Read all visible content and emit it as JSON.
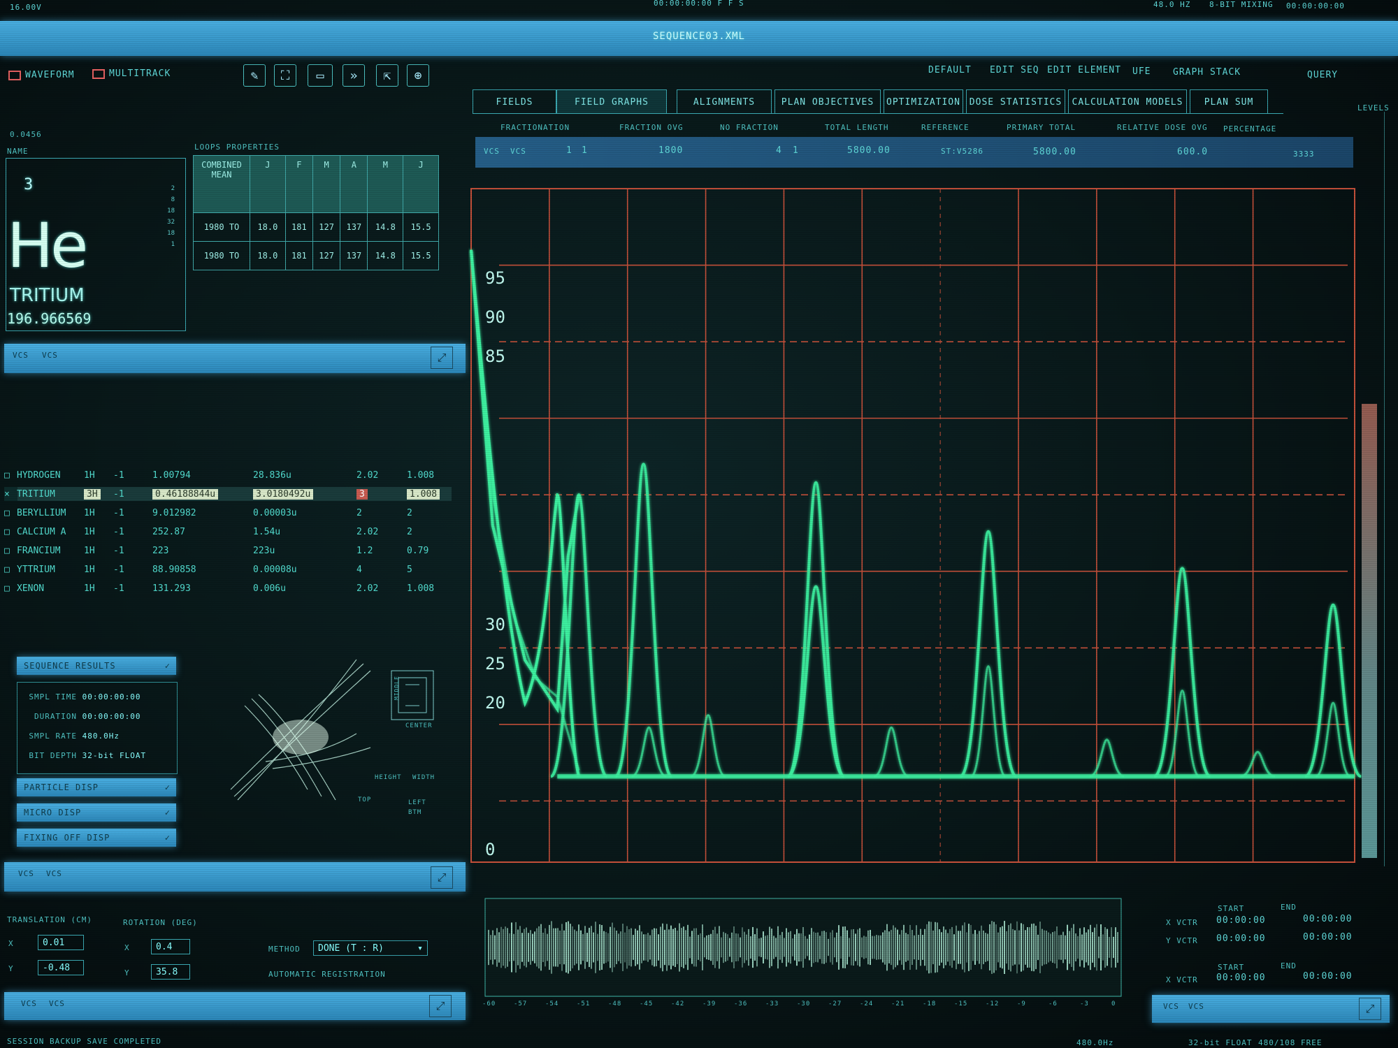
{
  "topbar": {
    "left": "16.00V",
    "center": "00:00:00:00 F F S",
    "right_rate": "48.0 HZ",
    "right_bits": "8-BIT MIXING",
    "right_tc": "00:00:00:00"
  },
  "title": "SEQUENCE03.XML",
  "toolbar": {
    "waveform": "WAVEFORM",
    "multitrack": "MULTITRACK"
  },
  "menu": [
    "DEFAULT",
    "EDIT SEQ",
    "EDIT ELEMENT",
    "UFE",
    "GRAPH STACK",
    "QUERY"
  ],
  "tabs": [
    "FIELDS",
    "FIELD GRAPHS",
    "ALIGNMENTS",
    "PLAN OBJECTIVES",
    "OPTIMIZATION",
    "DOSE STATISTICS",
    "CALCULATION MODELS",
    "PLAN SUM"
  ],
  "subheaders": [
    "FRACTIONATION",
    "FRACTION OVG",
    "NO FRACTION",
    "TOTAL LENGTH",
    "REFERENCE",
    "PRIMARY TOTAL",
    "RELATIVE DOSE OVG",
    "PERCENTAGE"
  ],
  "datarow": [
    "VCS",
    "VCS",
    "1",
    "1",
    "1800",
    "4",
    "1",
    "5800.00",
    "ST:V5286",
    "5800.00",
    "600.0",
    "3333"
  ],
  "levels_label": "LEVELS",
  "element": {
    "small_label": "0.0456",
    "name_label": "NAME",
    "number": "3",
    "symbol": "He",
    "name": "TRITIUM",
    "mass": "196.966569",
    "shells": [
      "2",
      "8",
      "18",
      "32",
      "18",
      "1"
    ]
  },
  "loops": {
    "title": "LOOPS  PROPERTIES",
    "headers": [
      "COMBINED MEAN",
      "J",
      "F",
      "M",
      "A",
      "M",
      "J"
    ],
    "rows": [
      [
        "1980  TO",
        "18.0",
        "181",
        "127",
        "137",
        "14.8",
        "15.5"
      ],
      [
        "1980  TO",
        "18.0",
        "181",
        "127",
        "137",
        "14.8",
        "15.5"
      ]
    ]
  },
  "vcs_bar": {
    "a": "VCS",
    "b": "VCS"
  },
  "elements": [
    {
      "name": "HYDROGEN",
      "iso": "1H",
      "charge": "-1",
      "mass": "1.00794",
      "unit": "28.836u",
      "v1": "2.02",
      "v2": "1.008"
    },
    {
      "name": "TRITIUM",
      "iso": "3H",
      "charge": "-1",
      "mass": "0.46188844u",
      "unit": "3.0180492u",
      "v1": "3",
      "v2": "1.008"
    },
    {
      "name": "BERYLLIUM",
      "iso": "1H",
      "charge": "-1",
      "mass": "9.012982",
      "unit": "0.00003u",
      "v1": "2",
      "v2": "2"
    },
    {
      "name": "CALCIUM A",
      "iso": "1H",
      "charge": "-1",
      "mass": "252.87",
      "unit": "1.54u",
      "v1": "2.02",
      "v2": "2"
    },
    {
      "name": "FRANCIUM",
      "iso": "1H",
      "charge": "-1",
      "mass": "223",
      "unit": "223u",
      "v1": "1.2",
      "v2": "0.79"
    },
    {
      "name": "YTTRIUM",
      "iso": "1H",
      "charge": "-1",
      "mass": "88.90858",
      "unit": "0.00008u",
      "v1": "4",
      "v2": "5"
    },
    {
      "name": "XENON",
      "iso": "1H",
      "charge": "-1",
      "mass": "131.293",
      "unit": "0.006u",
      "v1": "2.02",
      "v2": "1.008"
    }
  ],
  "results": {
    "title": "SEQUENCE RESULTS",
    "lines": [
      {
        "k": "SMPL TIME",
        "v": "00:00:00:00"
      },
      {
        "k": "DURATION",
        "v": "00:00:00:00"
      },
      {
        "k": "SMPL RATE",
        "v": "480.0Hz"
      },
      {
        "k": "BIT DEPTH",
        "v": "32-bit FLOAT"
      }
    ],
    "pills": [
      "PARTICLE DISP",
      "MICRO DISP",
      "FIXING OFF DISP"
    ]
  },
  "viz": {
    "center": "CENTER",
    "height": "HEIGHT",
    "width": "WIDTH",
    "left": "LEFT",
    "btm": "BTM",
    "top": "TOP",
    "mid": "MIDDLE"
  },
  "translation": {
    "title": "TRANSLATION (CM)",
    "x_label": "X",
    "x": "0.01",
    "y_label": "Y",
    "y": "-0.48"
  },
  "rotation": {
    "title": "ROTATION (DEG)",
    "x_label": "X",
    "x": "0.4",
    "y_label": "Y",
    "y": "35.8"
  },
  "method": {
    "label": "METHOD",
    "value": "DONE (T : R)",
    "auto": "AUTOMATIC REGISTRATION"
  },
  "vectors": {
    "start": "START",
    "end": "END",
    "rows": [
      {
        "label": "X VCTR",
        "start": "00:00:00",
        "end": "00:00:00"
      },
      {
        "label": "Y VCTR",
        "start": "00:00:00",
        "end": "00:00:00"
      },
      {
        "label": "X VCTR",
        "start": "00:00:00",
        "end": "00:00:00"
      }
    ]
  },
  "status": {
    "left": "SESSION BACKUP SAVE COMPLETED",
    "r1": "480.0Hz",
    "r2": "32-bit FLOAT",
    "r3": "480/108 FREE"
  },
  "chart_data": {
    "type": "line",
    "y_tick_labels": [
      "95",
      "90",
      "85",
      "30",
      "25",
      "20",
      "0"
    ],
    "grid": true,
    "series": [
      {
        "x": [
          0,
          2,
          5,
          8,
          9,
          10,
          11,
          13,
          15,
          20,
          24,
          27,
          28,
          29,
          30,
          33,
          36,
          40,
          44,
          49,
          55
        ],
        "y": [
          100,
          55,
          33,
          25,
          50,
          60,
          52,
          16,
          13,
          13,
          14,
          16,
          22,
          21,
          16,
          14,
          14,
          14,
          13,
          14,
          14
        ]
      },
      {
        "x": [
          0,
          1,
          2,
          4,
          6,
          8,
          10,
          12,
          14,
          16,
          18,
          20,
          22,
          24,
          26,
          28,
          30,
          32,
          34,
          36,
          38,
          40,
          42,
          44,
          46,
          48,
          50,
          52,
          54,
          56
        ],
        "y": [
          100,
          80,
          60,
          40,
          30,
          27,
          15,
          14,
          15,
          22,
          14,
          14,
          14,
          14,
          14,
          14,
          14,
          14,
          14,
          14,
          14,
          14,
          14,
          14,
          14,
          14,
          14,
          14,
          14,
          14
        ]
      }
    ],
    "peaks": [
      {
        "x": 10,
        "y": 60
      },
      {
        "x": 16,
        "y": 65
      },
      {
        "x": 16.5,
        "y": 22
      },
      {
        "x": 22,
        "y": 24
      },
      {
        "x": 32,
        "y": 62
      },
      {
        "x": 32,
        "y": 45
      },
      {
        "x": 39,
        "y": 22
      },
      {
        "x": 48,
        "y": 54
      },
      {
        "x": 48,
        "y": 32
      },
      {
        "x": 59,
        "y": 20
      },
      {
        "x": 66,
        "y": 48
      },
      {
        "x": 66,
        "y": 28
      },
      {
        "x": 73,
        "y": 18
      },
      {
        "x": 80,
        "y": 42
      },
      {
        "x": 80,
        "y": 26
      }
    ],
    "baseline": 14,
    "ylim": [
      0,
      110
    ],
    "xlim": [
      0,
      82
    ]
  },
  "ruler_labels": [
    "-60",
    "-57",
    "-54",
    "-51",
    "-48",
    "-45",
    "-42",
    "-39",
    "-36",
    "-33",
    "-30",
    "-27",
    "-24",
    "-21",
    "-18",
    "-15",
    "-12",
    "-9",
    "-6",
    "-3",
    "0"
  ],
  "colors": {
    "grid": "#c4503a",
    "trace": "#3df0a0",
    "accent": "#49aee0"
  }
}
